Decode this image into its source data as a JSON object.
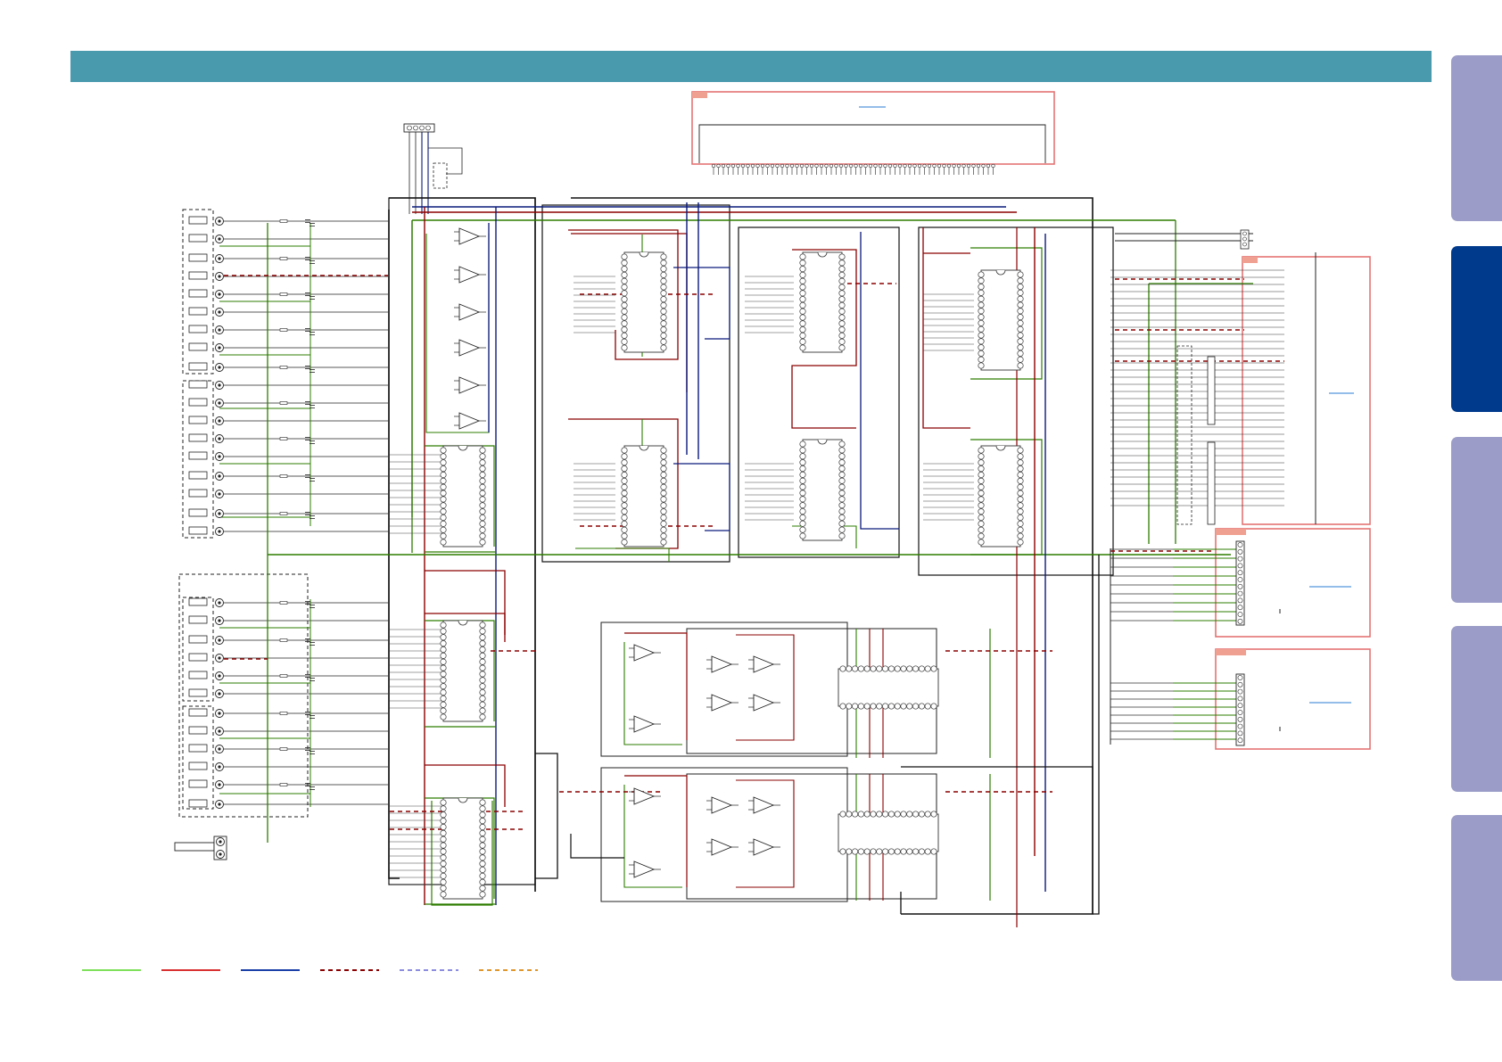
{
  "header": {
    "color": "#4a9aae"
  },
  "side_tabs": [
    {
      "state": "inactive",
      "color": "#9b9dc8"
    },
    {
      "state": "active",
      "color": "#003a8c"
    },
    {
      "state": "inactive",
      "color": "#9b9dc8"
    },
    {
      "state": "inactive",
      "color": "#9b9dc8"
    },
    {
      "state": "inactive",
      "color": "#9b9dc8"
    }
  ],
  "wire_colors": {
    "green": "#2e7d00",
    "red": "#8b0000",
    "blue": "#0a1a7a",
    "black": "#111111",
    "gray": "#555555",
    "pink_box": "#e57373"
  },
  "legend": [
    {
      "style": "solid",
      "color": "#7ee05a"
    },
    {
      "style": "solid",
      "color": "#d93030"
    },
    {
      "style": "solid",
      "color": "#1a3fa8"
    },
    {
      "style": "dashed",
      "color": "#8b0000"
    },
    {
      "style": "dashed",
      "color": "#8c8ce0"
    },
    {
      "style": "dashed",
      "color": "#e0962a"
    }
  ],
  "components": {
    "op_amp_icon": "triangle-op-amp",
    "ic_chip_icon": "dip-ic-chip",
    "jack_icon": "rca-jack"
  }
}
